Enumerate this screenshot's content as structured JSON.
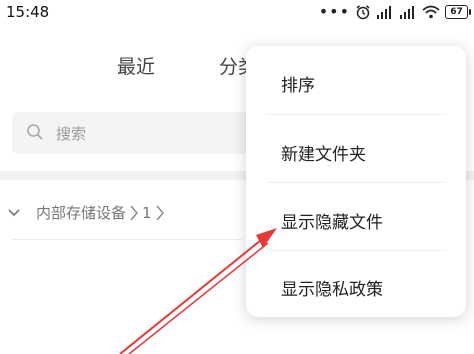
{
  "status_bar": {
    "time": "15:48",
    "battery": "67",
    "icons": [
      "more-dots-icon",
      "alarm-icon",
      "signal-icon",
      "signal-icon",
      "wifi-icon",
      "battery-icon"
    ]
  },
  "tabs": {
    "recent": "最近",
    "category": "分类"
  },
  "search": {
    "placeholder": "搜索"
  },
  "breadcrumb": {
    "storage": "内部存储设备",
    "folder": "1"
  },
  "menu": {
    "items": [
      {
        "label": "排序"
      },
      {
        "label": "新建文件夹"
      },
      {
        "label": "显示隐藏文件"
      },
      {
        "label": "显示隐私政策"
      }
    ]
  },
  "annotation": {
    "arrow_color": "#e8383a"
  }
}
